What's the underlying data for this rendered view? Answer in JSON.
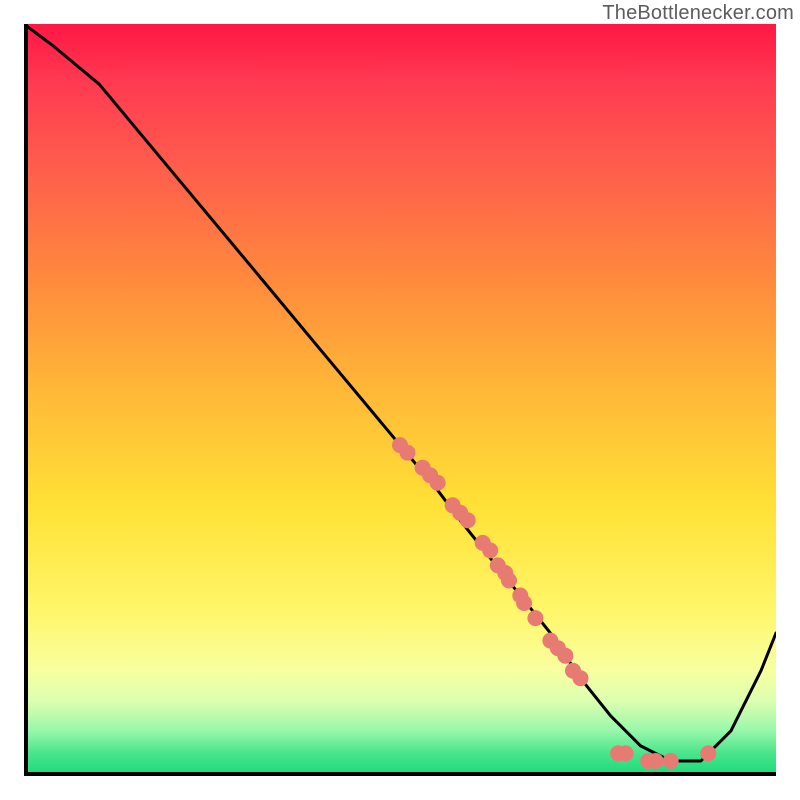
{
  "watermark": "TheBottlenecker.com",
  "colors": {
    "curve": "#000000",
    "point": "#e87a74",
    "axis": "#000000",
    "gradient_top": "#ff1744",
    "gradient_bottom": "#19d97b"
  },
  "chart_data": {
    "type": "line",
    "title": "",
    "xlabel": "",
    "ylabel": "",
    "xlim": [
      0,
      100
    ],
    "ylim": [
      0,
      100
    ],
    "series": [
      {
        "name": "curve",
        "x": [
          0,
          4,
          10,
          20,
          30,
          40,
          50,
          55,
          58,
          62,
          66,
          70,
          74,
          78,
          82,
          86,
          90,
          94,
          98,
          100
        ],
        "values": [
          100,
          97,
          92,
          80,
          68,
          56,
          44,
          38,
          34,
          29,
          24,
          19,
          13,
          8,
          4,
          2,
          2,
          6,
          14,
          19
        ]
      }
    ],
    "points": [
      {
        "x": 50,
        "y": 44
      },
      {
        "x": 51,
        "y": 43
      },
      {
        "x": 53,
        "y": 41
      },
      {
        "x": 54,
        "y": 40
      },
      {
        "x": 55,
        "y": 39
      },
      {
        "x": 57,
        "y": 36
      },
      {
        "x": 58,
        "y": 35
      },
      {
        "x": 59,
        "y": 34
      },
      {
        "x": 61,
        "y": 31
      },
      {
        "x": 62,
        "y": 30
      },
      {
        "x": 63,
        "y": 28
      },
      {
        "x": 64,
        "y": 27
      },
      {
        "x": 64.5,
        "y": 26
      },
      {
        "x": 66,
        "y": 24
      },
      {
        "x": 66.5,
        "y": 23
      },
      {
        "x": 68,
        "y": 21
      },
      {
        "x": 70,
        "y": 18
      },
      {
        "x": 71,
        "y": 17
      },
      {
        "x": 72,
        "y": 16
      },
      {
        "x": 73,
        "y": 14
      },
      {
        "x": 74,
        "y": 13
      },
      {
        "x": 79,
        "y": 3
      },
      {
        "x": 80,
        "y": 3
      },
      {
        "x": 83,
        "y": 2
      },
      {
        "x": 84,
        "y": 2
      },
      {
        "x": 86,
        "y": 2
      },
      {
        "x": 91,
        "y": 3
      }
    ]
  }
}
